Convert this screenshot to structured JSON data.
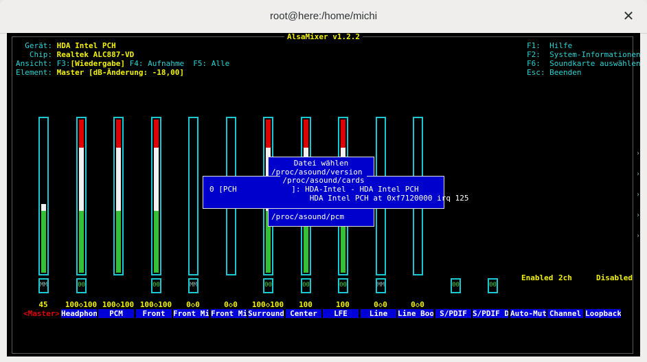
{
  "window": {
    "title": "root@here:/home/michi"
  },
  "app": {
    "title": "AlsaMixer v1.2.2"
  },
  "info": [
    {
      "label": "  Gerät: ",
      "value": "HDA Intel PCH",
      "rest": ""
    },
    {
      "label": "   Chip: ",
      "value": "Realtek ALC887-VD",
      "rest": ""
    },
    {
      "label": "Ansicht: F3:",
      "value": "[Wiedergabe]",
      "rest": " F4: Aufnahme  F5: Alle"
    },
    {
      "label": "Element: ",
      "value": "Master [dB-Änderung: -18,00]",
      "rest": ""
    }
  ],
  "help": [
    "F1:  Hilfe",
    "F2:  System-Informationen",
    "F6:  Soundkarte auswählen",
    "Esc: Beenden"
  ],
  "channels": [
    {
      "label": "<Master>",
      "volume": "45",
      "mute": "MM",
      "level": 0.45,
      "selected": true
    },
    {
      "label": "Headphon",
      "volume": "100◇100",
      "mute": "00",
      "level": 1.0
    },
    {
      "label": "PCM",
      "volume": "100◇100",
      "mute": "",
      "level": 1.0
    },
    {
      "label": "Front",
      "volume": "100◇100",
      "mute": "00",
      "level": 1.0
    },
    {
      "label": "Front Mi",
      "volume": "0◇0",
      "mute": "MM",
      "level": 0
    },
    {
      "label": "Front Mi",
      "volume": "0◇0",
      "mute": "",
      "level": 0
    },
    {
      "label": "Surround",
      "volume": "100◇100",
      "mute": "00",
      "level": 1.0
    },
    {
      "label": "Center",
      "volume": "100",
      "mute": "00",
      "level": 1.0
    },
    {
      "label": "LFE",
      "volume": "100",
      "mute": "00",
      "level": 1.0
    },
    {
      "label": "Line",
      "volume": "0◇0",
      "mute": "MM",
      "level": 0
    },
    {
      "label": "Line Boo",
      "volume": "0◇0",
      "mute": "",
      "level": 0
    },
    {
      "label": "S/PDIF",
      "volume": "",
      "mute": "00",
      "level": null
    },
    {
      "label": "S/PDIF D",
      "volume": "",
      "mute": "00",
      "level": null
    },
    {
      "label": "Auto-Mut",
      "volume": "",
      "mute": "",
      "level": null,
      "status": "Enabled"
    },
    {
      "label": "Channel",
      "volume": "",
      "mute": "",
      "level": null,
      "status": "2ch"
    },
    {
      "label": "Loopback",
      "volume": "",
      "mute": "",
      "level": null,
      "status": "Disabled"
    }
  ],
  "dialog_file": {
    "title": "Datei wählen",
    "items": [
      "/proc/asound/version",
      "/proc/asound/cards",
      "/proc/asound/pcm"
    ]
  },
  "dialog_cards": {
    "title": "/proc/asound/cards",
    "lines": [
      "0 [PCH            ]: HDA-Intel - HDA Intel PCH",
      "                      HDA Intel PCH at 0xf7120000 irq 125"
    ]
  },
  "colors": {
    "term_bg": "#000000",
    "cyan": "#28d3d3",
    "yellow": "#f2f200",
    "label_bg": "#0000d8",
    "red": "#e00000",
    "green": "#35c135"
  }
}
